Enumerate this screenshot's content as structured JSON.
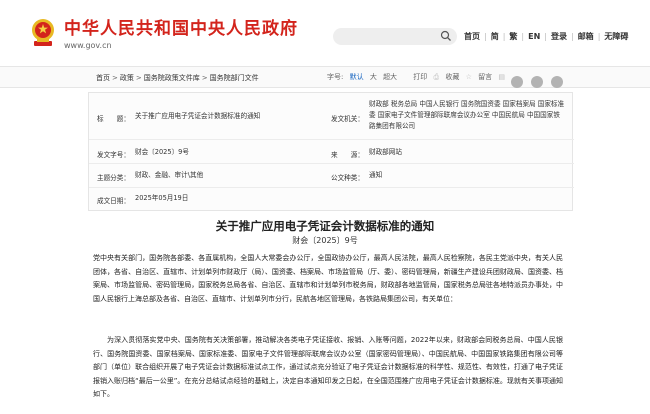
{
  "header": {
    "site_title": "中华人民共和国中央人民政府",
    "site_url": "www.gov.cn",
    "search_placeholder": "",
    "nav": [
      "首页",
      "简",
      "繁",
      "EN",
      "登录",
      "邮箱",
      "无障碍"
    ]
  },
  "breadcrumb": [
    "首页",
    "政策",
    "国务院政策文件库",
    "国务院部门文件"
  ],
  "tools": {
    "font_label": "字号:",
    "font_default": "默认",
    "font_large": "大",
    "font_xlarge": "超大",
    "print": "打印",
    "favorite": "收藏",
    "keep": "留言"
  },
  "info": {
    "title_label": "标　　题：",
    "title_value": "关于推广应用电子凭证会计数据标准的通知",
    "issuer_label": "发文机关：",
    "issuer_value": "财政部  税务总局  中国人民银行  国务院国资委  国家档案局  国家标准委  国家电子文件管理部际联席会议办公室  中国民航局  中国国家铁路集团有限公司",
    "doc_no_label": "发文字号：",
    "doc_no_value": "财会〔2025〕9号",
    "source_label": "来　　源：",
    "source_value": "财政部网站",
    "category_label": "主题分类：",
    "category_value": "财政、金融、审计\\其他",
    "type_label": "公文种类：",
    "type_value": "通知",
    "date_label": "成文日期：",
    "date_value": "2025年05月19日"
  },
  "article": {
    "title": "关于推广应用电子凭证会计数据标准的通知",
    "number": "财会〔2025〕9号",
    "p1": "党中央有关部门，国务院各部委、各直属机构，全国人大常委会办公厅，全国政协办公厅，最高人民法院，最高人民检察院，各民主党派中央，有关人民团体，各省、自治区、直辖市、计划单列市财政厅（局）、国资委、档案局、市场监管局（厅、委）、密码管理局，新疆生产建设兵团财政局、国资委、档案局、市场监管局、密码管理局，国家税务总局各省、自治区、直辖市和计划单列市税务局，财政部各地监管局，国家税务总局驻各地特派员办事处，中国人民银行上海总部及各省、自治区、直辖市、计划单列市分行，民航各地区管理局，各铁路局集团公司，有关单位：",
    "p2": "为深入贯彻落实党中央、国务院有关决策部署，推动解决各类电子凭证接收、报销、入账等问题，2022年以来，财政部会同税务总局、中国人民银行、国务院国资委、国家档案局、国家标准委、国家电子文件管理部际联席会议办公室（国家密码管理局）、中国民航局、中国国家铁路集团有限公司等部门（单位）联合组织开展了电子凭证会计数据标准试点工作，通过试点充分验证了电子凭证会计数据标准的科学性、规范性、有效性，打通了电子凭证报销入账归档“最后一公里”。在充分总结试点经验的基础上，决定自本通知印发之日起，在全国范围推广应用电子凭证会计数据标准。现就有关事项通知如下。"
  },
  "colors": {
    "brand_red": "#d3241c",
    "link_blue": "#1463c0"
  }
}
